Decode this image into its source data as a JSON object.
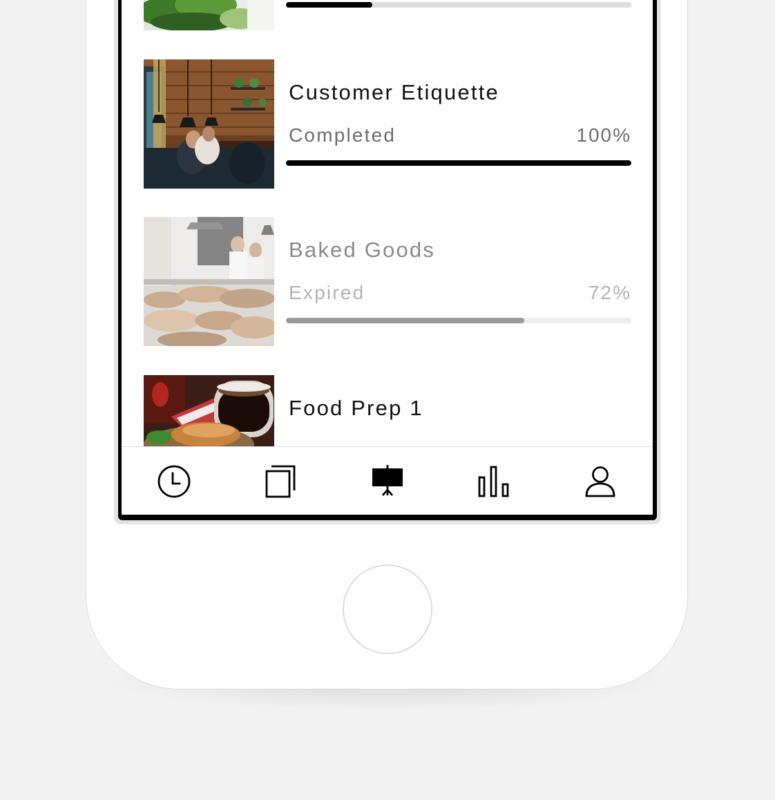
{
  "courses": [
    {
      "title": "",
      "status": "",
      "percent": "",
      "progress": 0.25,
      "state": "in-progress"
    },
    {
      "title": "Customer Etiquette",
      "status": "Completed",
      "percent": "100%",
      "progress": 1.0,
      "state": "completed"
    },
    {
      "title": "Baked Goods",
      "status": "Expired",
      "percent": "72%",
      "progress": 0.69,
      "state": "expired"
    },
    {
      "title": "Food Prep 1",
      "status": "",
      "percent": "",
      "progress": 0,
      "state": "in-progress"
    }
  ],
  "tabbar": {
    "active": "presentation",
    "tabs": [
      {
        "icon": "clock-icon"
      },
      {
        "icon": "copy-icon"
      },
      {
        "icon": "presentation-icon"
      },
      {
        "icon": "bar-chart-icon"
      },
      {
        "icon": "user-icon"
      }
    ]
  },
  "colors": {
    "background": "#f2f2f2",
    "screen_frame": "#000000",
    "progress_fill": "#000000",
    "progress_track": "#dedede",
    "expired_fill": "#9a9a9a"
  }
}
